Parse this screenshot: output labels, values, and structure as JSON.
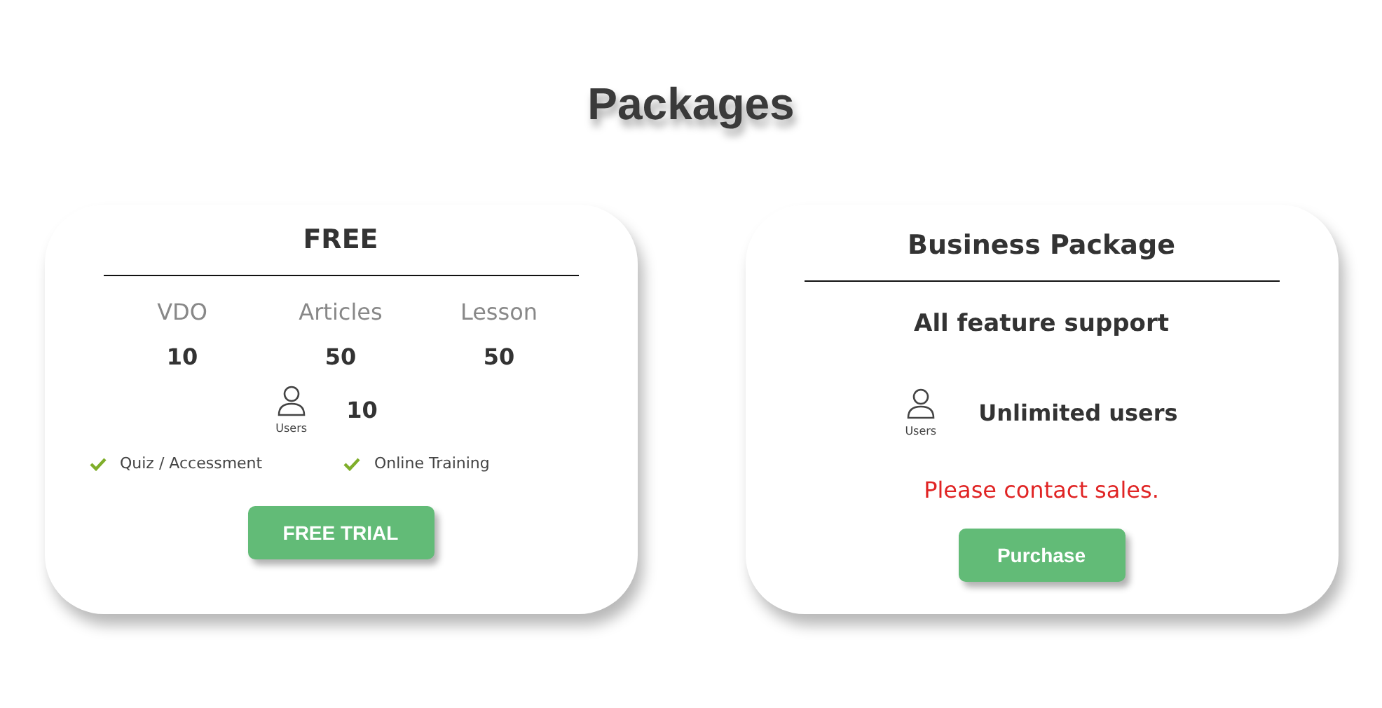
{
  "title": "Packages",
  "packages": [
    {
      "kind": "quota",
      "name": "FREE",
      "stats": [
        {
          "label": "VDO",
          "value": "10"
        },
        {
          "label": "Articles",
          "value": "50"
        },
        {
          "label": "Lesson",
          "value": "50"
        }
      ],
      "users": {
        "label": "Users",
        "value": "10"
      },
      "features": [
        "Quiz / Accessment",
        "Online Training"
      ],
      "button": "FREE TRIAL"
    },
    {
      "kind": "contact",
      "name": "Business Package",
      "subtitle": "All feature support",
      "users": {
        "label": "Users",
        "value": "Unlimited users"
      },
      "note": "Please contact sales.",
      "button": "Purchase"
    }
  ]
}
